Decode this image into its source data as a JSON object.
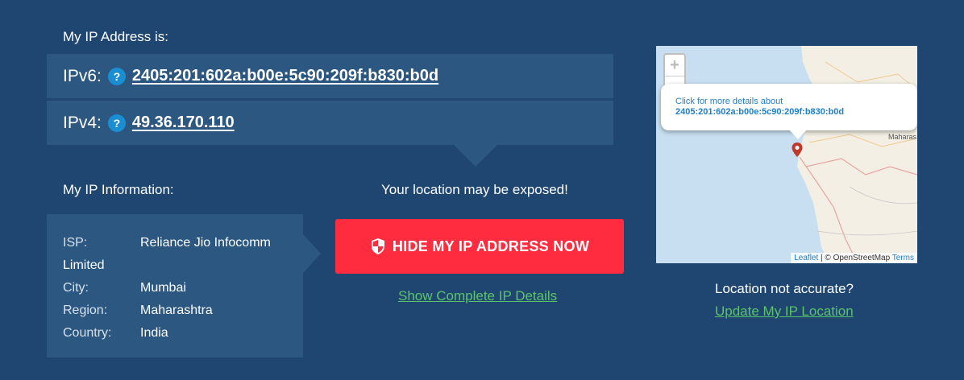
{
  "header": {
    "title": "My IP Address is:"
  },
  "ipv6": {
    "label": "IPv6:",
    "help": "?",
    "value": "2405:201:602a:b00e:5c90:209f:b830:b0d"
  },
  "ipv4": {
    "label": "IPv4:",
    "help": "?",
    "value": "49.36.170.110"
  },
  "info": {
    "title": "My IP Information:",
    "rows": [
      {
        "key": "ISP:",
        "value": "Reliance Jio Infocomm Limited"
      },
      {
        "key": "City:",
        "value": "Mumbai"
      },
      {
        "key": "Region:",
        "value": "Maharashtra"
      },
      {
        "key": "Country:",
        "value": "India"
      }
    ]
  },
  "warning": {
    "text": "Your location may be exposed!"
  },
  "cta": {
    "label": "HIDE MY IP ADDRESS NOW",
    "details_link": "Show Complete IP Details"
  },
  "map": {
    "zoom_in": "+",
    "zoom_out": "−",
    "popup_line1": "Click for more details about",
    "popup_line2": "2405:201:602a:b00e:5c90:209f:b830:b0d",
    "region_label": "Maharas",
    "attribution": {
      "leaflet": "Leaflet",
      "sep": " | © OpenStreetMap ",
      "terms": "Terms"
    }
  },
  "location": {
    "question": "Location not accurate?",
    "update_link": "Update My IP Location"
  },
  "colors": {
    "background": "#1f4671",
    "panel": "#2b5781",
    "cta": "#ff2c3f",
    "link_green": "#5cc36a",
    "help_blue": "#1b8ed2"
  }
}
